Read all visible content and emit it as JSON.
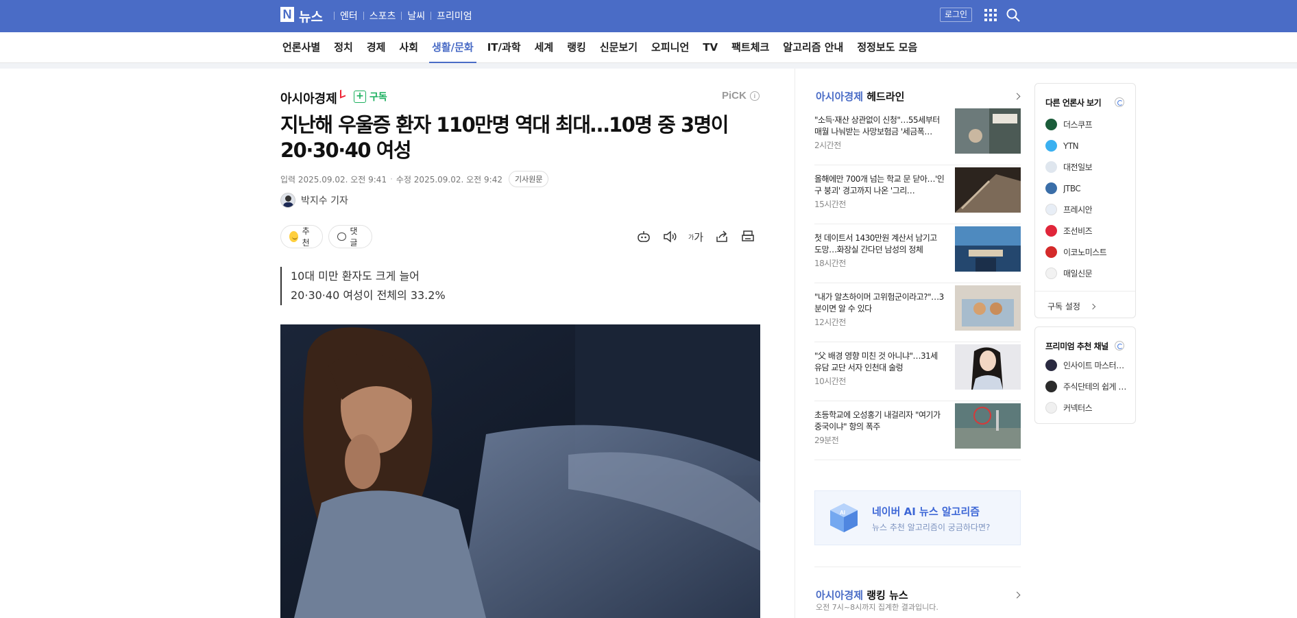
{
  "top": {
    "logo_n": "N",
    "logo_news": "뉴스",
    "links": [
      "엔터",
      "스포츠",
      "날씨",
      "프리미엄"
    ],
    "login": "로그인"
  },
  "nav": {
    "items": [
      "언론사별",
      "정치",
      "경제",
      "사회",
      "생활/문화",
      "IT/과학",
      "세계",
      "랭킹",
      "신문보기",
      "오피니언",
      "TV",
      "팩트체크",
      "알고리즘 안내",
      "정정보도 모음"
    ],
    "active": "생활/문화"
  },
  "article": {
    "press": "아시아경제",
    "subscribe": "구독",
    "pick": "PiCK",
    "headline": "지난해 우울증 환자 110만명 역대 최대…10명 중 3명이 20·30·40 여성",
    "input_date": "입력 2025.09.02. 오전 9:41",
    "modified_date": "수정 2025.09.02. 오전 9:42",
    "original_button": "기사원문",
    "reporter": "박지수 기자",
    "like_label": "추천",
    "comment_label": "댓글",
    "font_tool": "가",
    "summary": [
      "10대 미만 환자도 크게 늘어",
      "20·30·40 여성이 전체의 33.2%"
    ]
  },
  "headlines": {
    "brand": "아시아경제",
    "label": "헤드라인",
    "items": [
      {
        "text": "\"소득·재산 상관없이 신청\"…55세부터 매월 나눠받는 사망보험금 '세금폭…",
        "time": "2시간전"
      },
      {
        "text": "올해에만 700개 넘는 학교 문 닫아…'인구 붕괴' 경고까지 나온 '그리…",
        "time": "15시간전"
      },
      {
        "text": "첫 데이트서 1430만원 계산서 남기고 도망…화장실 간다던 남성의 정체",
        "time": "18시간전"
      },
      {
        "text": "\"내가 알츠하이머 고위험군이라고?\"…3분이면 알 수 있다",
        "time": "12시간전"
      },
      {
        "text": "\"父 배경 영향 미친 것 아니냐\"…31세 유담 교단 서자 인천대 술렁",
        "time": "10시간전"
      },
      {
        "text": "초등학교에 오성홍기 내걸리자 \"여기가 중국이냐\" 항의 폭주",
        "time": "29분전"
      }
    ]
  },
  "ai_box": {
    "title": "네이버 AI 뉴스 알고리즘",
    "subtitle": "뉴스 추천 알고리즘이 궁금하다면?"
  },
  "ranking": {
    "brand": "아시아경제",
    "label": "랭킹 뉴스",
    "sub": "오전 7시~8시까지 집계한 결과입니다."
  },
  "other_press": {
    "title": "다른 언론사 보기",
    "items": [
      {
        "name": "더스쿠프",
        "color": "#1a5c3a"
      },
      {
        "name": "YTN",
        "color": "#3ab0f0"
      },
      {
        "name": "대전일보",
        "color": "#dfe6ee"
      },
      {
        "name": "JTBC",
        "color": "#3a6ea8"
      },
      {
        "name": "프레시안",
        "color": "#e8eef6"
      },
      {
        "name": "조선비즈",
        "color": "#e0263a"
      },
      {
        "name": "이코노미스트",
        "color": "#d42a2a"
      },
      {
        "name": "매일신문",
        "color": "#f2f2f2"
      }
    ],
    "footer": "구독 설정"
  },
  "premium": {
    "title": "프리미엄 추천 채널",
    "items": [
      {
        "name": "인사이트 마스터…",
        "color": "#2a2a40"
      },
      {
        "name": "주식단테의 쉽게 …",
        "color": "#2b2b2b"
      },
      {
        "name": "커넥터스",
        "color": "#f0f0f0"
      }
    ]
  },
  "colors": {
    "brand_blue": "#4a6cc6",
    "subscribe_green": "#1aaf5d"
  }
}
